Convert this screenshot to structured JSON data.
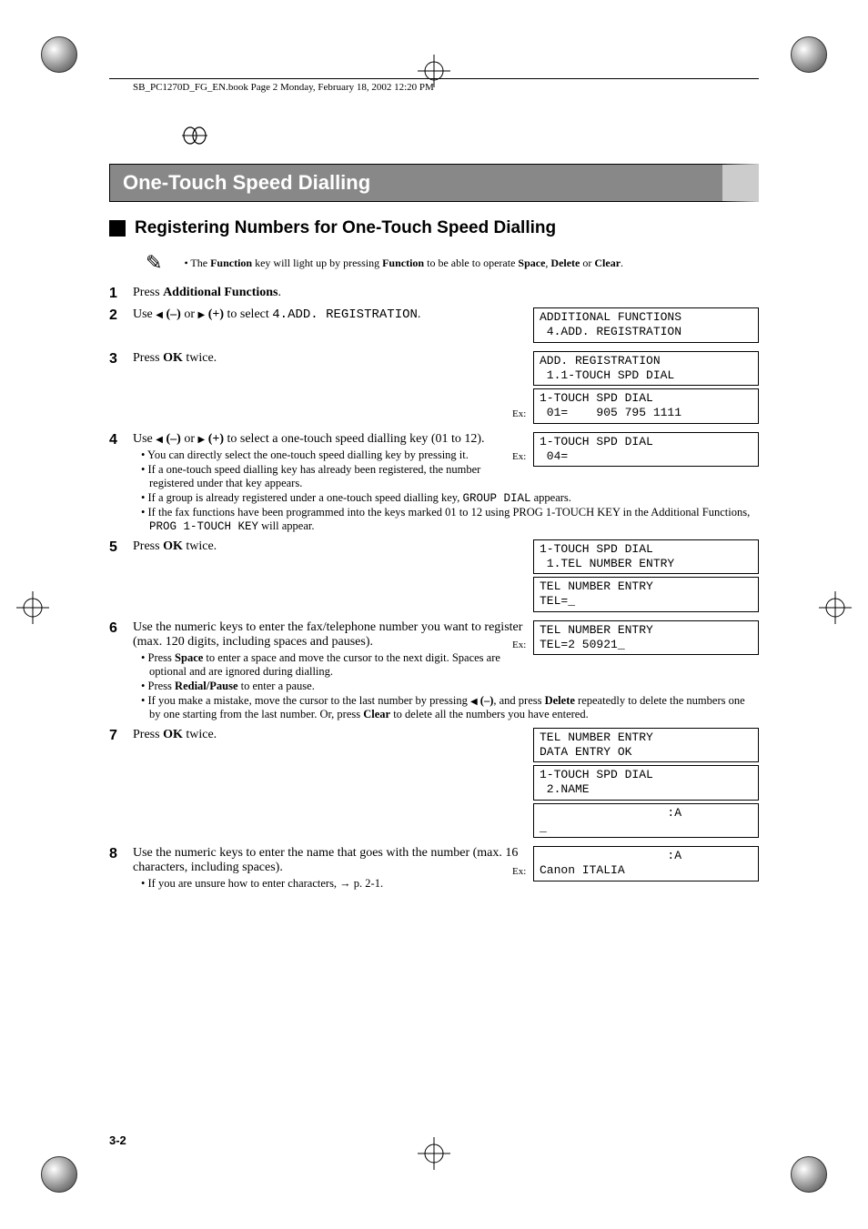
{
  "meta": {
    "header_text": "SB_PC1270D_FG_EN.book  Page 2  Monday, February 18, 2002  12:20 PM",
    "page_number": "3-2"
  },
  "title_bar": "One-Touch Speed Dialling",
  "section_title": "Registering Numbers for One-Touch Speed Dialling",
  "note": {
    "prefix": "• The ",
    "k1": "Function",
    "mid1": " key will light up by pressing ",
    "k2": "Function",
    "mid2": " to be able to operate ",
    "k3": "Space",
    "sep1": ", ",
    "k4": "Delete",
    "sep2": " or ",
    "k5": "Clear",
    "suffix": "."
  },
  "steps": {
    "s1": {
      "num": "1",
      "t1": "Press ",
      "b1": "Additional Functions",
      "t2": "."
    },
    "s2": {
      "num": "2",
      "t1": "Use ",
      "lbl_minus": " (–)",
      "t2": " or ",
      "lbl_plus": " (+)",
      "t3": " to select ",
      "mono": "4.ADD. REGISTRATION",
      "t4": ".",
      "disp1_l1": "ADDITIONAL FUNCTIONS",
      "disp1_l2": " 4.ADD. REGISTRATION"
    },
    "s3": {
      "num": "3",
      "t1": "Press ",
      "b1": "OK",
      "t2": " twice.",
      "disp1_l1": "ADD. REGISTRATION",
      "disp1_l2": " 1.1-TOUCH SPD DIAL",
      "disp2_l1": "1-TOUCH SPD DIAL",
      "disp2_l2": " 01=    905 795 1111",
      "ex": "Ex:"
    },
    "s4": {
      "num": "4",
      "t1": "Use ",
      "lbl_minus": " (–)",
      "t2": " or ",
      "lbl_plus": " (+)",
      "t3": " to select a one-touch speed dialling key (01 to 12).",
      "b1": "• You can directly select the one-touch speed dialling key by pressing it.",
      "b2": "• If a one-touch speed dialling key has already been registered, the number registered under that key appears.",
      "b3a": "• If a group is already registered under a one-touch speed dialling key, ",
      "b3mono": "GROUP DIAL",
      "b3b": " appears.",
      "b4a": "• If the fax functions have been programmed into the keys marked 01 to 12 using PROG 1-TOUCH KEY in the Additional Functions, ",
      "b4mono": "PROG 1-TOUCH KEY",
      "b4b": " will appear.",
      "disp1_l1": "1-TOUCH SPD DIAL",
      "disp1_l2": " 04=",
      "ex": "Ex:"
    },
    "s5": {
      "num": "5",
      "t1": "Press ",
      "b1": "OK",
      "t2": " twice.",
      "disp1_l1": "1-TOUCH SPD DIAL",
      "disp1_l2": " 1.TEL NUMBER ENTRY",
      "disp2_l1": "TEL NUMBER ENTRY",
      "disp2_l2": "TEL=_"
    },
    "s6": {
      "num": "6",
      "t1": "Use the numeric keys to enter the fax/telephone number you want to register (max. 120 digits, including spaces and pauses).",
      "b1a": "• Press ",
      "b1k": "Space",
      "b1b": " to enter a space and move the cursor to the next digit. Spaces are optional and are ignored during dialling.",
      "b2a": "• Press ",
      "b2k": "Redial/Pause",
      "b2b": " to enter a pause.",
      "b3a": "• If you make a mistake, move the cursor to the last number by pressing ",
      "b3minus": " (–)",
      "b3b": ", and press ",
      "b3k1": "Delete",
      "b3c": " repeatedly to delete the numbers one by one starting from the last number. Or, press ",
      "b3k2": "Clear",
      "b3d": " to delete all the numbers you have entered.",
      "disp1_l1": "TEL NUMBER ENTRY",
      "disp1_l2": "TEL=2 50921_",
      "ex": "Ex:"
    },
    "s7": {
      "num": "7",
      "t1": "Press ",
      "b1": "OK",
      "t2": " twice.",
      "disp1_l1": "TEL NUMBER ENTRY",
      "disp1_l2": "DATA ENTRY OK",
      "disp2_l1": "1-TOUCH SPD DIAL",
      "disp2_l2": " 2.NAME",
      "disp3_l1": "                  :A",
      "disp3_l2": "_"
    },
    "s8": {
      "num": "8",
      "t1": "Use the numeric keys to enter the name that goes with the number (max. 16 characters, including spaces).",
      "b1": "• If you are unsure how to enter characters, → p. 2-1.",
      "disp1_l1": "                  :A",
      "disp1_l2": "Canon ITALIA",
      "ex": "Ex:"
    }
  }
}
